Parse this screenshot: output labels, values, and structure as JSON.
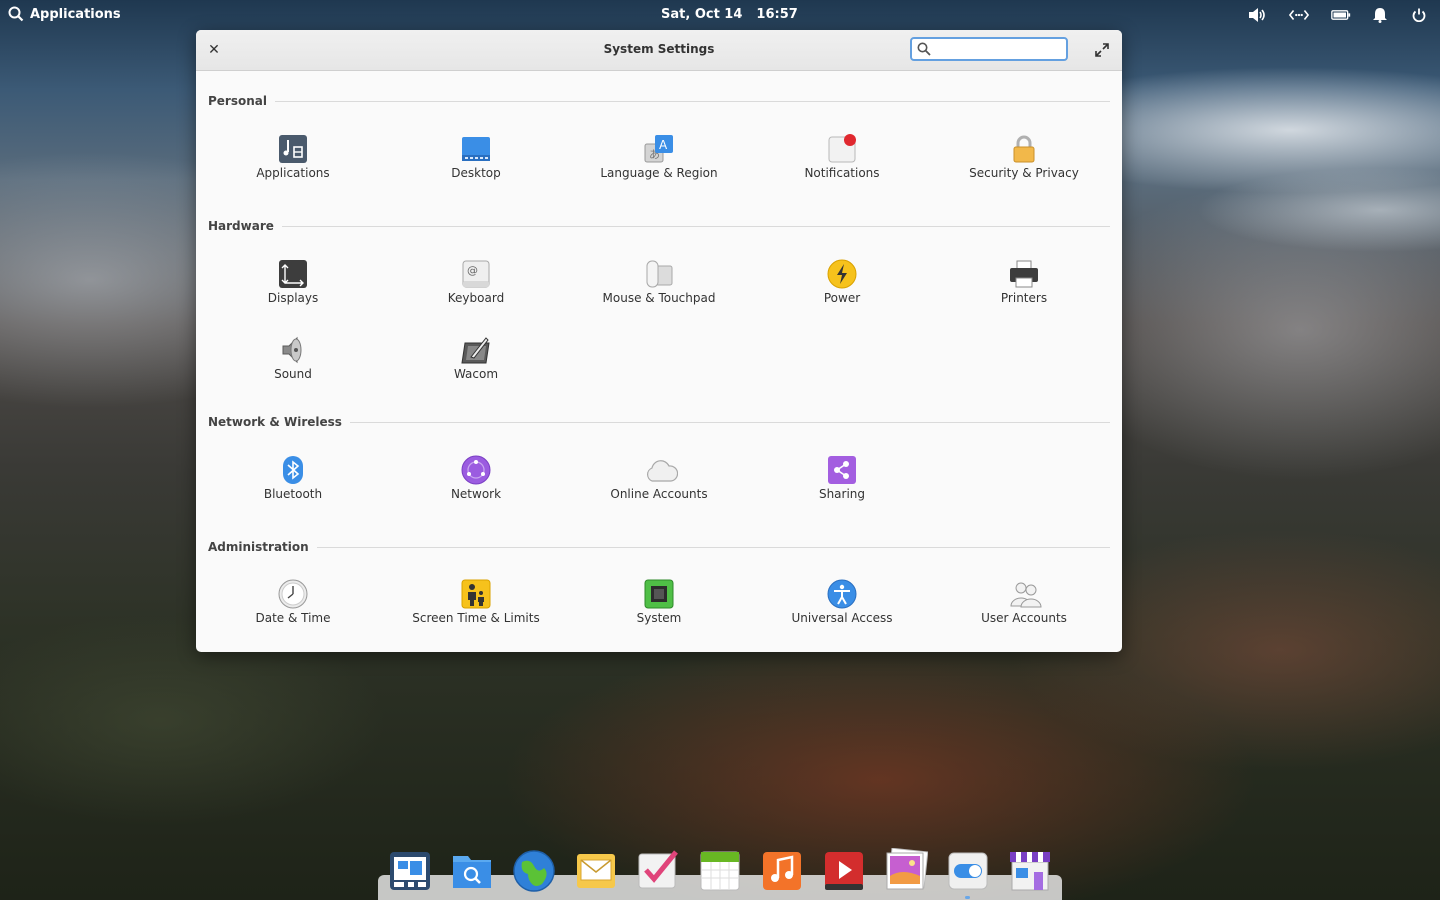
{
  "panel": {
    "applications_label": "Applications",
    "date": "Sat, Oct 14",
    "time": "16:57",
    "indicators": [
      "volume-icon",
      "network-icon",
      "battery-icon",
      "notifications-icon",
      "power-icon"
    ]
  },
  "window": {
    "title": "System Settings",
    "search_placeholder": ""
  },
  "sections": {
    "personal": {
      "title": "Personal",
      "items": [
        "Applications",
        "Desktop",
        "Language & Region",
        "Notifications",
        "Security & Privacy"
      ]
    },
    "hardware": {
      "title": "Hardware",
      "items": [
        "Displays",
        "Keyboard",
        "Mouse & Touchpad",
        "Power",
        "Printers",
        "Sound",
        "Wacom"
      ]
    },
    "network": {
      "title": "Network & Wireless",
      "items": [
        "Bluetooth",
        "Network",
        "Online Accounts",
        "Sharing"
      ]
    },
    "admin": {
      "title": "Administration",
      "items": [
        "Date & Time",
        "Screen Time & Limits",
        "System",
        "Universal Access",
        "User Accounts"
      ]
    }
  },
  "dock": {
    "apps": [
      "multitasking-view",
      "files",
      "web-browser",
      "mail",
      "tasks",
      "calendar",
      "music",
      "videos",
      "photos",
      "system-settings",
      "appcenter"
    ],
    "running_indicator": "system-settings"
  }
}
